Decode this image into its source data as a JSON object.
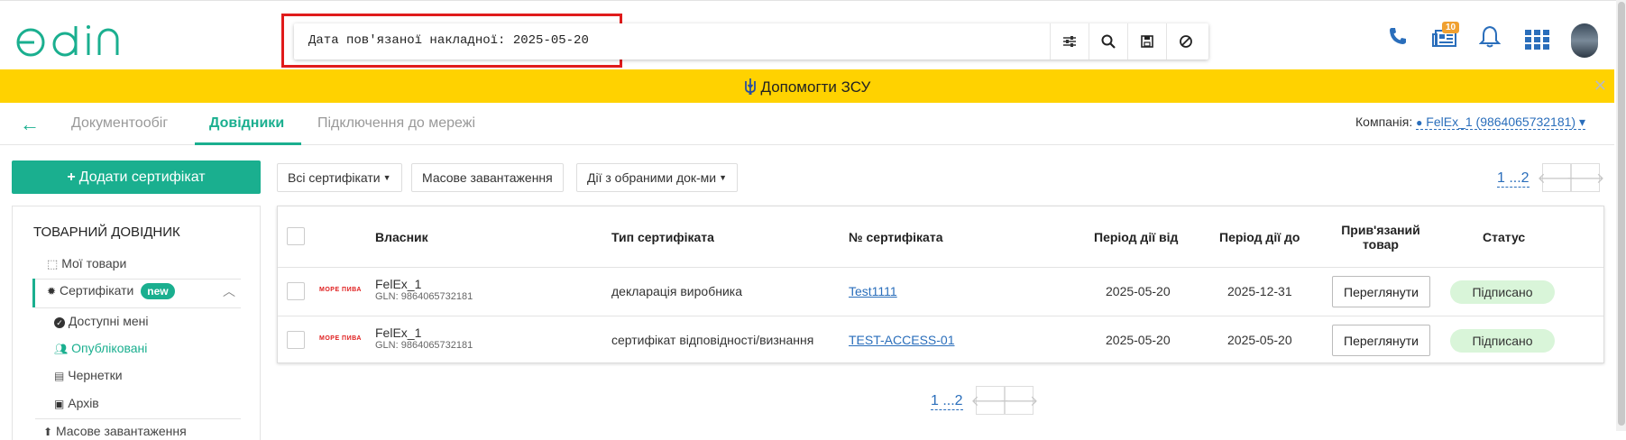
{
  "header": {
    "logo_text": "edin",
    "search_query": "Дата пов'язаної накладної: 2025-05-20",
    "notifications_badge": "10",
    "icons": [
      "filter-icon",
      "search-icon",
      "save-icon",
      "clear-icon",
      "phone-icon",
      "news-icon",
      "bell-icon",
      "apps-icon",
      "avatar"
    ]
  },
  "banner": {
    "text": "Допомогти ЗСУ",
    "close": "✕"
  },
  "nav": {
    "back": "←",
    "tabs": [
      {
        "label": "Документообіг",
        "active": false
      },
      {
        "label": "Довідники",
        "active": true
      },
      {
        "label": "Підключення до мережі",
        "active": false
      }
    ],
    "company_label": "Компанія:",
    "company_value": "FelEx_1 (9864065732181)"
  },
  "sidebar": {
    "add_button": "Додати сертифікат",
    "heading": "ТОВАРНИЙ ДОВІДНИК",
    "items": [
      {
        "label": "Мої товари"
      },
      {
        "label": "Сертифікати",
        "badge": "new"
      },
      {
        "label": "Доступні мені"
      },
      {
        "label": "Опубліковані"
      },
      {
        "label": "Чернетки"
      },
      {
        "label": "Архів"
      },
      {
        "label": "Масове завантаження"
      }
    ]
  },
  "toolbar": {
    "filter_all": "Всі сертифікати",
    "bulk_upload": "Масове завантаження",
    "selected_actions": "Дії з обраними док-ми",
    "pager_top": "1 ...2",
    "pager_bottom": "1 ...2"
  },
  "table": {
    "columns": [
      "Власник",
      "Тип сертифіката",
      "№ сертифіката",
      "Період дії від",
      "Період дії до",
      "Прив'язаний товар",
      "Статус"
    ],
    "rows": [
      {
        "logo": "МОРЕ ПИВА",
        "owner": "FelEx_1",
        "gln": "GLN: 9864065732181",
        "type": "декларація виробника",
        "number": "Test1111",
        "from": "2025-05-20",
        "to": "2025-12-31",
        "action": "Переглянути",
        "status": "Підписано"
      },
      {
        "logo": "МОРЕ ПИВА",
        "owner": "FelEx_1",
        "gln": "GLN: 9864065732181",
        "type": "сертифікат відповідності/визнання",
        "number": "TEST-ACCESS-01",
        "from": "2025-05-20",
        "to": "2025-05-20",
        "action": "Переглянути",
        "status": "Підписано"
      }
    ]
  },
  "colors": {
    "brand": "#1aaf8f",
    "banner": "#ffd200",
    "link": "#2a6ebb",
    "highlight": "#e01b1b",
    "status_bg": "#d9f5d9"
  }
}
